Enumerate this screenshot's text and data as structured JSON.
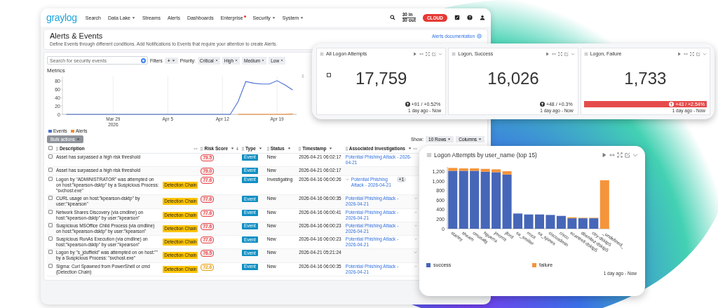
{
  "nav": {
    "logo": "graylog",
    "items": [
      {
        "label": "Search",
        "dropdown": false,
        "badge": false
      },
      {
        "label": "Data Lake",
        "dropdown": true,
        "badge": false
      },
      {
        "label": "Streams",
        "dropdown": false,
        "badge": false
      },
      {
        "label": "Alerts",
        "dropdown": false,
        "badge": false
      },
      {
        "label": "Dashboards",
        "dropdown": false,
        "badge": false
      },
      {
        "label": "Enterprise",
        "dropdown": false,
        "badge": true
      },
      {
        "label": "Security",
        "dropdown": true,
        "badge": false
      },
      {
        "label": "System",
        "dropdown": true,
        "badge": false
      }
    ],
    "throughput_in": "30 in",
    "throughput_out": "30 out",
    "cloud_badge": "CLOUD"
  },
  "page": {
    "title": "Alerts & Events",
    "subtitle": "Define Events through different conditions. Add Notifications to Events that require your attention to create Alerts.",
    "doc_link": "Alerts documentation"
  },
  "filters": {
    "search_placeholder": "Search for security events",
    "label": "Filters",
    "add_button": "+",
    "priority_label": "Priority:",
    "chips": [
      "Critical",
      "High",
      "Medium",
      "Low"
    ]
  },
  "metrics": {
    "title": "Metrics",
    "chart_data": {
      "type": "line",
      "categories": [
        null,
        null,
        null,
        null,
        null,
        null,
        "Mar 29 2026",
        null,
        null,
        null,
        null,
        null,
        null,
        "Apr 5",
        null,
        null,
        null,
        null,
        null,
        null,
        "Apr 12",
        null,
        null,
        null,
        null,
        null,
        null,
        "Apr 19",
        null,
        null
      ],
      "grid": true,
      "yticks": [
        0,
        20,
        40,
        60,
        80
      ],
      "ylim": [
        0,
        90
      ],
      "series": [
        {
          "name": "Events",
          "color": "#4a6fd0",
          "values": [
            0,
            0,
            0,
            0,
            0,
            0,
            0,
            0,
            0,
            0,
            0,
            0,
            0,
            0,
            0,
            0,
            0,
            0,
            0,
            0,
            0,
            0,
            30,
            78,
            74,
            72,
            72,
            80,
            70,
            58
          ]
        },
        {
          "name": "Alerts",
          "color": "#f28b30",
          "values": [
            null,
            null,
            null,
            null,
            null,
            null,
            null,
            null,
            null,
            null,
            null,
            null,
            null,
            null,
            null,
            null,
            null,
            null,
            null,
            null,
            null,
            null,
            0,
            0,
            0,
            0,
            0,
            0,
            0,
            1
          ]
        }
      ]
    }
  },
  "bulk_actions": {
    "label": "Bulk actions",
    "disabled": true
  },
  "table_controls": {
    "show_label": "Show:",
    "rows_button": "10 Rows",
    "columns_button": "Columns"
  },
  "table": {
    "all_checked": false,
    "columns": [
      {
        "label": "Description",
        "sorted": false,
        "resizable": true
      },
      {
        "label": "Risk Score",
        "sorted": true,
        "resizable": false
      },
      {
        "label": "Type",
        "sorted": false,
        "resizable": false
      },
      {
        "label": "Status",
        "sorted": false,
        "resizable": false
      },
      {
        "label": "Timestamp",
        "sorted": false,
        "resizable": false
      },
      {
        "label": "Associated Investigations",
        "sorted": false,
        "resizable": true
      }
    ],
    "rows": [
      {
        "checked": false,
        "description": "Asset has surpassed a high risk threshold",
        "risk_score": "79.5",
        "high_risk": true,
        "type": "Event",
        "status": "New",
        "timestamp": "2026-04-21 06:02:17",
        "investigation": "Potential Phishing Attack - 2026-04-21",
        "expandable": false
      },
      {
        "checked": false,
        "description": "Asset has surpassed a high risk threshold",
        "risk_score": "79.0",
        "high_risk": true,
        "type": "Event",
        "status": "New",
        "timestamp": "2026-04-21 06:02:17",
        "expandable": false
      },
      {
        "checked": false,
        "description": "Logon by \"ADMINISTRATOR\" was attempted on on host:\"kpearson-dsktp\" by a Suspicious Process: \"svchost.exe\"",
        "tag": "Detection Chain",
        "risk_score": "77.6",
        "high_risk": true,
        "type": "Event",
        "status": "Investigating",
        "timestamp": "2026-04-16 06:00:26",
        "investigation": "Potential Phishing Attack - 2026-04-21",
        "expandable": true,
        "chevron_first": true,
        "extra_count": "+1"
      },
      {
        "checked": false,
        "description": "CURL usage on host:\"kpearson-dsktp\" by user:\"kpearson\"",
        "tag": "Detection Chain",
        "risk_score": "77.6",
        "high_risk": true,
        "type": "Event",
        "status": "New",
        "timestamp": "2026-04-16 06:00:35",
        "investigation": "Potential Phishing Attack - 2026-04-21",
        "expandable": true,
        "chevron_first": false
      },
      {
        "checked": false,
        "description": "Network Shares Discovery (via cmdline) on host:\"kpearson-dsktp\" by user:\"kpearson\"",
        "tag": "Detection Chain",
        "risk_score": "77.6",
        "high_risk": true,
        "type": "Event",
        "status": "New",
        "timestamp": "2026-04-16 06:00:41",
        "investigation": "Potential Phishing Attack - 2026-04-21",
        "expandable": true,
        "chevron_first": false
      },
      {
        "checked": false,
        "description": "Suspicious MSOffice Child Process (via cmdline) on host:\"kpearson-dsktp\" by user:\"kpearson\"",
        "tag": "Detection Chain",
        "risk_score": "77.6",
        "high_risk": true,
        "type": "Event",
        "status": "New",
        "timestamp": "2026-04-16 06:00:23",
        "investigation": "Potential Phishing Attack - 2026-04-21",
        "expandable": true,
        "chevron_first": false
      },
      {
        "checked": false,
        "description": "Suspicious RunAs Execution (via cmdline) on host:\"kpearson-dsktp\" by user:\"kpearson\"",
        "tag": "Detection Chain",
        "risk_score": "77.6",
        "high_risk": true,
        "type": "Event",
        "status": "New",
        "timestamp": "2026-04-16 06:00:23",
        "investigation": "Potential Phishing Attack - 2026-04-21",
        "expandable": true,
        "chevron_first": false
      },
      {
        "checked": false,
        "description": "Logon by \"s_jduffield\" was attempted on on host:\"\" by a Suspicious Process: \"svchost.exe\"",
        "tag": "Detection Chain",
        "risk_score": "76.5",
        "high_risk": true,
        "type": "Event",
        "status": "New",
        "timestamp": "2026-04-21 05:21:24",
        "expandable": true,
        "chevron_first": false
      },
      {
        "checked": false,
        "description": "Sigma: Curl Spawned from PowerShell or cmd (Detection Chain)",
        "tag": "Detection Chain",
        "risk_score": "72.6",
        "high_risk": false,
        "type": "Event",
        "status": "New",
        "timestamp": "2026-04-16 06:00:35",
        "investigation": "Potential Phishing Attack - 2026-04-21",
        "expandable": true,
        "chevron_first": false
      }
    ]
  },
  "stat_cards": [
    {
      "title": "All Logon Attempts",
      "value": "17,759",
      "delta": "+91 / +0.52%",
      "alert": false,
      "marker": true,
      "range": "1 day ago - Now"
    },
    {
      "title": "Logon, Success",
      "value": "16,026",
      "delta": "+48 / +0.3%",
      "alert": false,
      "marker": false,
      "range": "1 day ago - Now"
    },
    {
      "title": "Logon, Failure",
      "value": "1,733",
      "delta": "+43 / +2.54%",
      "alert": true,
      "marker": false,
      "range": "1 day ago - Now"
    }
  ],
  "bar_widget": {
    "title": "Logon Attempts by user_name (top 15)",
    "range": "1 day ago - Now",
    "chart_data": {
      "type": "bar",
      "stacked": true,
      "categories": [
        "starley",
        "sheam",
        "cmusafg",
        "hguerra",
        "jmorris",
        "jford",
        "sa_smiller",
        "rroot",
        "sa_sjones",
        "ciscoadmin",
        "cisco",
        "ecantrell-dsktp5",
        "dbenitez-dsktp5",
        "ctry-dsktp5",
        "_undefined_"
      ],
      "yticks": [
        0,
        200,
        400,
        600,
        800,
        {
          "value": 1000,
          "label": "1,000"
        },
        {
          "value": 1200,
          "label": "1,200"
        }
      ],
      "ylim": [
        0,
        1300
      ],
      "series": [
        {
          "name": "success",
          "color": "#4666b8",
          "values": [
            1220,
            1220,
            1220,
            1200,
            1190,
            1140,
            320,
            300,
            300,
            290,
            270,
            220,
            220,
            220,
            0
          ]
        },
        {
          "name": "failure",
          "color": "#f5943a",
          "values": [
            60,
            50,
            50,
            60,
            60,
            70,
            0,
            0,
            0,
            0,
            0,
            20,
            10,
            10,
            1020
          ]
        }
      ]
    }
  }
}
